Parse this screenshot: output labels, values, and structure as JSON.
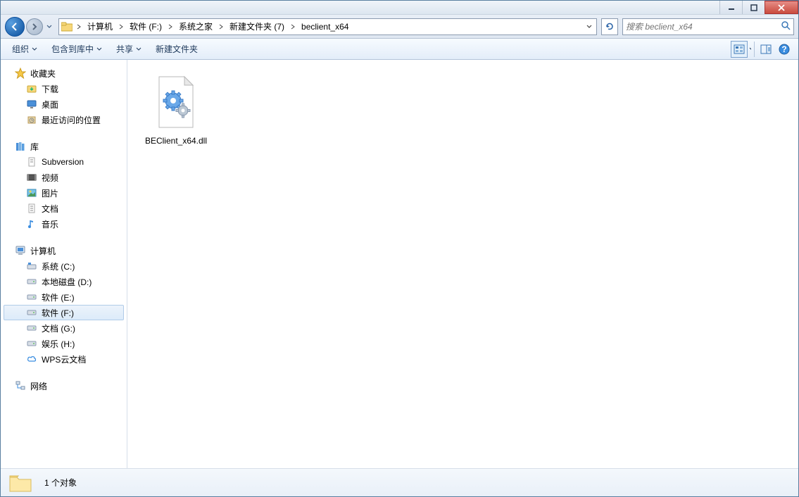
{
  "breadcrumb": {
    "items": [
      "计算机",
      "软件 (F:)",
      "系统之家",
      "新建文件夹 (7)",
      "beclient_x64"
    ]
  },
  "search": {
    "placeholder": "搜索 beclient_x64"
  },
  "toolbar": {
    "organize": "组织",
    "include": "包含到库中",
    "share": "共享",
    "newfolder": "新建文件夹"
  },
  "sidebar": {
    "favorites": {
      "label": "收藏夹",
      "items": [
        "下载",
        "桌面",
        "最近访问的位置"
      ]
    },
    "libraries": {
      "label": "库",
      "items": [
        "Subversion",
        "视频",
        "图片",
        "文档",
        "音乐"
      ]
    },
    "computer": {
      "label": "计算机",
      "items": [
        "系统 (C:)",
        "本地磁盘 (D:)",
        "软件 (E:)",
        "软件 (F:)",
        "文档 (G:)",
        "娱乐 (H:)",
        "WPS云文档"
      ]
    },
    "network": {
      "label": "网络"
    }
  },
  "files": [
    {
      "name": "BEClient_x64.dll"
    }
  ],
  "status": {
    "count": "1 个对象"
  }
}
